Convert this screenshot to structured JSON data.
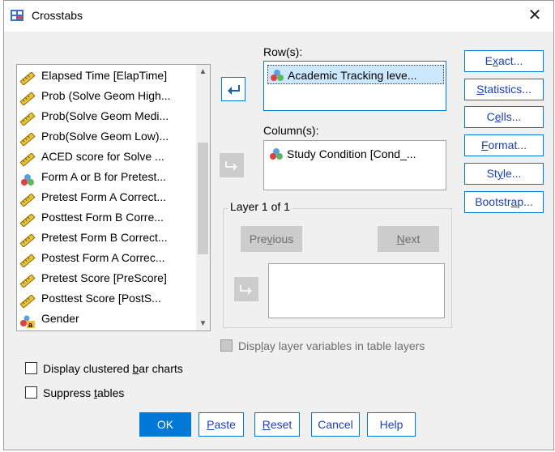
{
  "window": {
    "title": "Crosstabs",
    "close_glyph": "✕"
  },
  "variables": [
    {
      "label": "Elapsed Time [ElapTime]",
      "icon": "scale-ruler-icon"
    },
    {
      "label": "Prob (Solve Geom High...",
      "icon": "scale-ruler-icon"
    },
    {
      "label": "Prob(Solve Geom Medi...",
      "icon": "scale-ruler-icon"
    },
    {
      "label": "Prob(Solve Geom Low)...",
      "icon": "scale-ruler-icon"
    },
    {
      "label": "ACED score for Solve ...",
      "icon": "scale-ruler-icon"
    },
    {
      "label": "Form A or B for Pretest...",
      "icon": "nominal-circles-icon"
    },
    {
      "label": "Pretest Form A Correct...",
      "icon": "scale-ruler-icon"
    },
    {
      "label": "Posttest Form B Corre...",
      "icon": "scale-ruler-icon"
    },
    {
      "label": "Pretest Form B Correct...",
      "icon": "scale-ruler-icon"
    },
    {
      "label": "Postest Form A Correc...",
      "icon": "scale-ruler-icon"
    },
    {
      "label": "Pretest Score [PreScore]",
      "icon": "scale-ruler-icon"
    },
    {
      "label": "Posttest Score [PostS...",
      "icon": "scale-ruler-icon"
    },
    {
      "label": "Gender",
      "icon": "nominal-string-icon"
    }
  ],
  "rows": {
    "label": "Row(s):",
    "items": [
      "Academic Tracking leve..."
    ]
  },
  "columns": {
    "label": "Column(s):",
    "items": [
      "Study Condition [Cond_..."
    ]
  },
  "side_buttons": [
    "Exact...",
    "Statistics...",
    "Cells...",
    "Format...",
    "Style...",
    "Bootstrap..."
  ],
  "layer": {
    "title": "Layer 1 of 1",
    "previous": "Previous",
    "next": "Next"
  },
  "checkboxes": {
    "display_layer": "Display layer variables in table layers",
    "clustered": "Display clustered bar charts",
    "suppress": "Suppress tables"
  },
  "bottom_buttons": {
    "ok": "OK",
    "paste": "Paste",
    "reset": "Reset",
    "cancel": "Cancel",
    "help": "Help"
  },
  "colors": {
    "accent": "#0078d7",
    "dialog_bg": "#f0f0f0",
    "selection": "#cce8ff",
    "disabled": "#cccccc"
  }
}
